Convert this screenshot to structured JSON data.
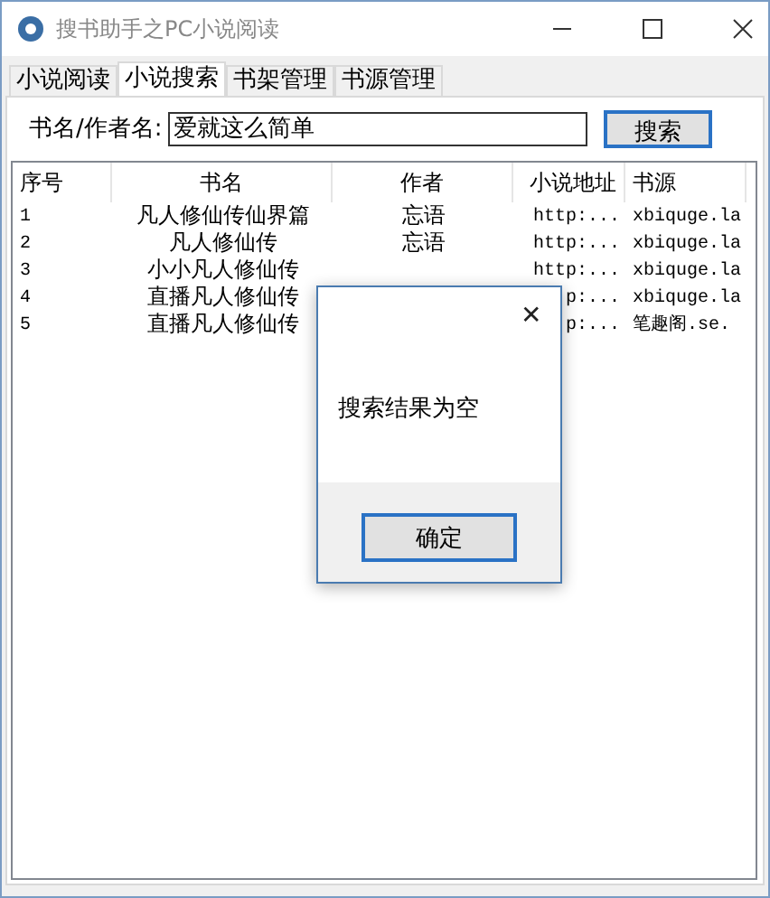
{
  "window": {
    "title": "搜书助手之PC小说阅读"
  },
  "tabs": [
    {
      "label": "小说阅读",
      "selected": false
    },
    {
      "label": "小说搜索",
      "selected": true
    },
    {
      "label": "书架管理",
      "selected": false
    },
    {
      "label": "书源管理",
      "selected": false
    }
  ],
  "search": {
    "label": "书名/作者名:",
    "value": "爱就这么简单",
    "button": "搜索"
  },
  "table": {
    "columns": [
      "序号",
      "书名",
      "作者",
      "小说地址",
      "书源"
    ],
    "rows": [
      [
        "1",
        "凡人修仙传仙界篇",
        "忘语",
        "http:...",
        "xbiquge.la"
      ],
      [
        "2",
        "凡人修仙传",
        "忘语",
        "http:...",
        "xbiquge.la"
      ],
      [
        "3",
        "小小凡人修仙传",
        "",
        "http:...",
        "xbiquge.la"
      ],
      [
        "4",
        "直播凡人修仙传",
        "",
        "p:...",
        "xbiquge.la"
      ],
      [
        "5",
        "直播凡人修仙传",
        "",
        "p:...",
        "笔趣阁.se."
      ]
    ]
  },
  "dialog": {
    "message": "搜索结果为空",
    "button": "确定",
    "close": "✕"
  }
}
